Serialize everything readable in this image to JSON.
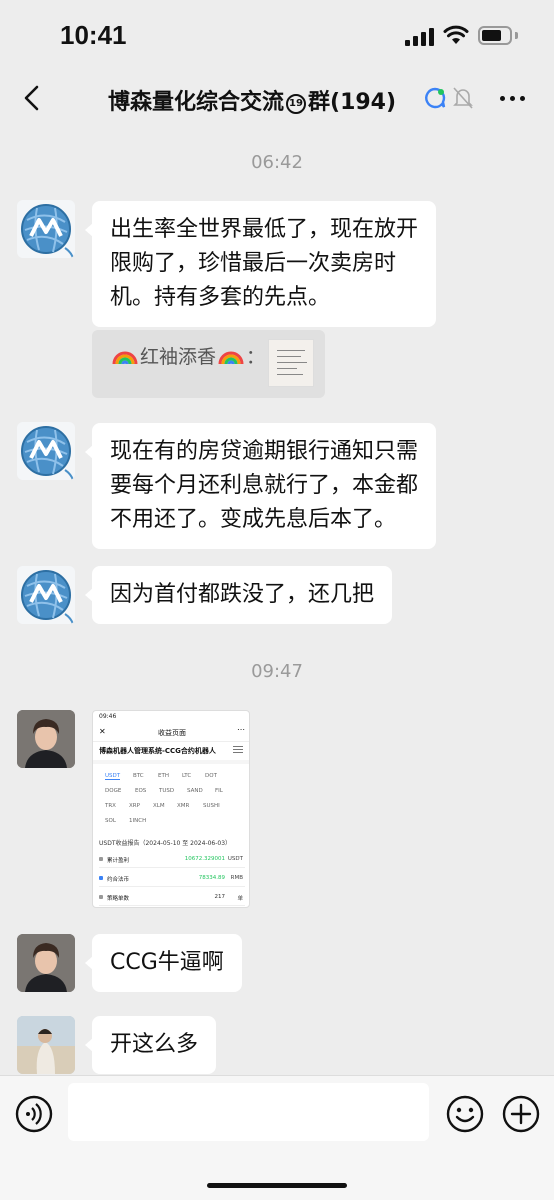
{
  "status_bar": {
    "time": "10:41",
    "battery_level": 0.72
  },
  "header": {
    "title_prefix": "博森量化综合交流",
    "title_badge": "19",
    "title_suffix": "群(194)"
  },
  "chat": {
    "timestamps": [
      "06:42",
      "09:47"
    ],
    "messages": [
      {
        "avatar": "yarn-ball-avatar",
        "lines": [
          "出生率全世界最低了，现在放开",
          "限购了，珍惜最后一次卖房时",
          "机。持有多套的先点。"
        ]
      },
      {
        "avatar": "yarn-ball-avatar",
        "lines": [
          "现在有的房贷逾期银行通知只需",
          "要每个月还利息就行了，本金都",
          "不用还了。变成先息后本了。"
        ]
      },
      {
        "avatar": "yarn-ball-avatar",
        "lines": [
          "因为首付都跌没了，还几把"
        ]
      },
      {
        "avatar": "young-man-avatar",
        "lines": [
          "CCG牛逼啊"
        ]
      },
      {
        "avatar": "beach-person-avatar",
        "lines": [
          "开这么多"
        ]
      }
    ],
    "quote": {
      "name": "红袖添香",
      "separator": "："
    }
  },
  "screenshot": {
    "status_time": "09:46",
    "header_title": "收益页面",
    "app_title": "博森机器人管理系统-CCG合约机器人",
    "tabs_row1": [
      "USDT",
      "BTC",
      "ETH",
      "LTC",
      "DOT"
    ],
    "tabs_row2": [
      "DOGE",
      "EOS",
      "TUSD",
      "SAND",
      "FIL"
    ],
    "tabs_row3": [
      "TRX",
      "XRP",
      "XLM",
      "XMR",
      "SUSHI"
    ],
    "tabs_row4": [
      "SOL",
      "1INCH"
    ],
    "period": "USDT收益报告（2024-05-10 至 2024-06-03）",
    "rows": [
      {
        "label": "累计盈利",
        "value": "10672.329001",
        "unit": "USDT"
      },
      {
        "label": "约合法币",
        "value": "78334.89",
        "unit": "RMB"
      },
      {
        "label": "策略单数",
        "value": "217",
        "unit": "单"
      }
    ]
  },
  "colors": {
    "accent_green": "#22c55e",
    "accent_blue": "#3b82f6",
    "chat_bg": "#ededed"
  }
}
